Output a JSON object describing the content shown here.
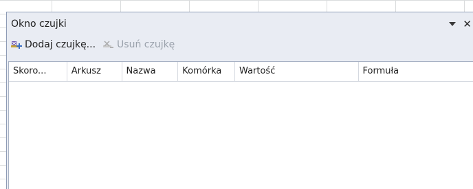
{
  "watch_window": {
    "title": "Okno czujki",
    "toolbar": {
      "add_label": "Dodaj czujkę...",
      "remove_label": "Usuń czujkę"
    },
    "columns": [
      "Skoro...",
      "Arkusz",
      "Nazwa",
      "Komórka",
      "Wartość",
      "Formuła"
    ],
    "rows": []
  },
  "colors": {
    "panel_bg": "#e9ecf3",
    "disabled_text": "#9aa1ab"
  },
  "icons": [
    "add-watch-icon",
    "remove-watch-icon",
    "dropdown-arrow-icon",
    "close-icon"
  ]
}
